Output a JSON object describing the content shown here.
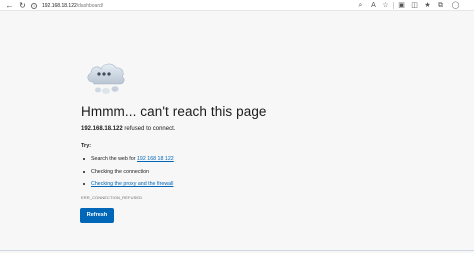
{
  "toolbar": {
    "url_host": "192.168.18.122",
    "url_path": "/dashboard/"
  },
  "page": {
    "heading": "Hmmm... can't reach this page",
    "host": "192.168.18.122",
    "refused_text": " refused to connect.",
    "try_label": "Try:",
    "suggestions": {
      "search_prefix": "Search the web for ",
      "search_link": "192 168 18 122",
      "checking_connection": "Checking the connection",
      "proxy_link": "Checking the proxy and the firewall"
    },
    "error_code": "ERR_CONNECTION_REFUSED",
    "refresh_label": "Refresh"
  },
  "colors": {
    "accent": "#0067b8",
    "background": "#f7f7f7"
  },
  "icons": [
    "back-icon",
    "reload-icon",
    "info-icon",
    "search-icon",
    "read-aloud-icon",
    "favorite-icon",
    "extensions-icon",
    "split-screen-icon",
    "favorites-bar-icon",
    "collections-icon",
    "profile-icon",
    "cloud-error-icon"
  ]
}
